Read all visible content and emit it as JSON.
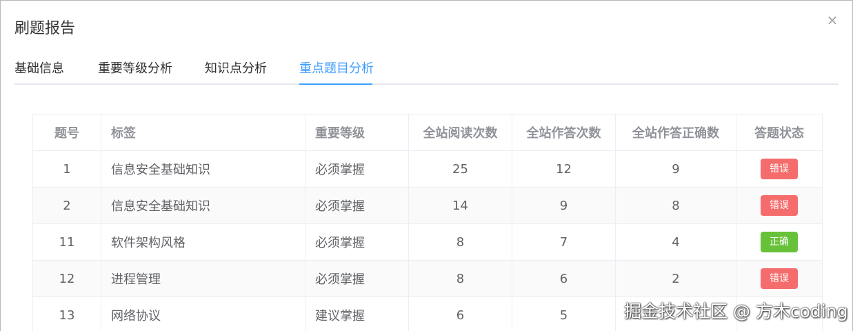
{
  "dialog": {
    "title": "刷题报告",
    "close_symbol": "×"
  },
  "tabs": [
    {
      "label": "基础信息",
      "active": false
    },
    {
      "label": "重要等级分析",
      "active": false
    },
    {
      "label": "知识点分析",
      "active": false
    },
    {
      "label": "重点题目分析",
      "active": true
    }
  ],
  "table": {
    "headers": [
      "题号",
      "标签",
      "重要等级",
      "全站阅读次数",
      "全站作答次数",
      "全站作答正确数",
      "答题状态"
    ],
    "rows": [
      {
        "num": "1",
        "tag": "信息安全基础知识",
        "level": "必须掌握",
        "reads": "25",
        "answers": "12",
        "correct": "9",
        "status": "错误",
        "status_color": "#f56c6c"
      },
      {
        "num": "2",
        "tag": "信息安全基础知识",
        "level": "必须掌握",
        "reads": "14",
        "answers": "9",
        "correct": "8",
        "status": "错误",
        "status_color": "#f56c6c"
      },
      {
        "num": "11",
        "tag": "软件架构风格",
        "level": "必须掌握",
        "reads": "8",
        "answers": "7",
        "correct": "4",
        "status": "正确",
        "status_color": "#67c23a"
      },
      {
        "num": "12",
        "tag": "进程管理",
        "level": "必须掌握",
        "reads": "8",
        "answers": "6",
        "correct": "2",
        "status": "错误",
        "status_color": "#f56c6c"
      },
      {
        "num": "13",
        "tag": "网络协议",
        "level": "建议掌握",
        "reads": "6",
        "answers": "5",
        "correct": "",
        "status": "",
        "status_color": "#909399"
      }
    ]
  },
  "watermark": "掘金技术社区 @ 方木coding",
  "colors": {
    "accent": "#409eff",
    "error": "#f56c6c",
    "success": "#67c23a"
  }
}
